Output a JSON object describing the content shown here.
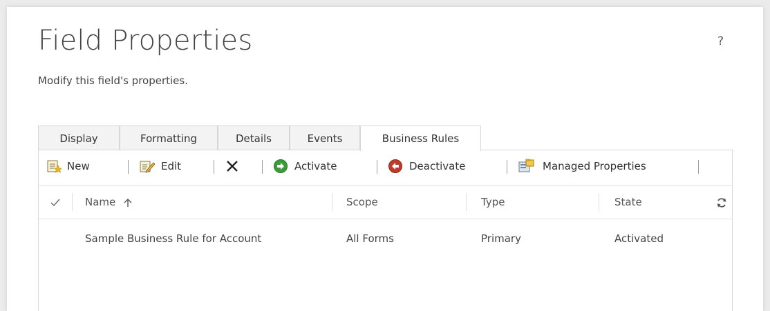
{
  "header": {
    "title": "Field Properties",
    "subtitle": "Modify this field's properties.",
    "help_label": "?"
  },
  "tabs": [
    {
      "label": "Display",
      "active": false
    },
    {
      "label": "Formatting",
      "active": false
    },
    {
      "label": "Details",
      "active": false
    },
    {
      "label": "Events",
      "active": false
    },
    {
      "label": "Business Rules",
      "active": true
    }
  ],
  "toolbar": {
    "new_label": "New",
    "edit_label": "Edit",
    "activate_label": "Activate",
    "deactivate_label": "Deactivate",
    "managed_properties_label": "Managed Properties",
    "icons": [
      "new-icon",
      "edit-icon",
      "delete-icon",
      "activate-icon",
      "deactivate-icon",
      "managed-properties-icon"
    ]
  },
  "grid": {
    "columns": [
      "Name",
      "Scope",
      "Type",
      "State"
    ],
    "sort_column": "Name",
    "sort_direction": "ascending",
    "rows": [
      {
        "name": "Sample Business Rule for Account",
        "scope": "All Forms",
        "type": "Primary",
        "state": "Activated"
      }
    ]
  },
  "colors": {
    "activate_green": "#3a9b3a",
    "deactivate_red": "#c0392b",
    "tab_border": "#d6d6d6"
  }
}
